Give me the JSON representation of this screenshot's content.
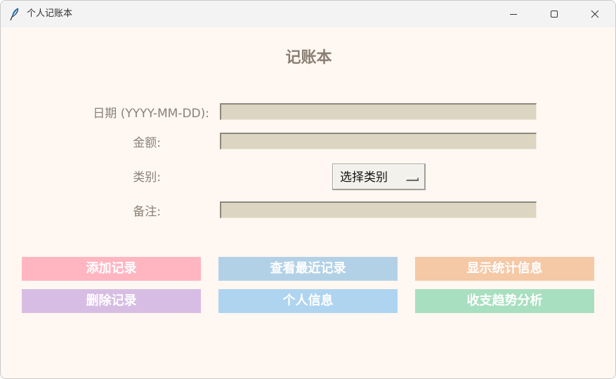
{
  "window": {
    "title": "个人记账本"
  },
  "form": {
    "heading": "记账本",
    "fields": {
      "date": {
        "label": "日期 (YYYY-MM-DD):",
        "value": ""
      },
      "amount": {
        "label": "金额:",
        "value": ""
      },
      "category": {
        "label": "类别:",
        "selected": "选择类别"
      },
      "note": {
        "label": "备注:",
        "value": ""
      }
    }
  },
  "actions": {
    "add": {
      "label": "添加记录",
      "color": "#ffb6c1"
    },
    "view_recent": {
      "label": "查看最近记录",
      "color": "#b3d1e6"
    },
    "stats": {
      "label": "显示统计信息",
      "color": "#f5c8a6"
    },
    "delete": {
      "label": "删除记录",
      "color": "#d7bde3"
    },
    "profile": {
      "label": "个人信息",
      "color": "#aed4f0"
    },
    "trend": {
      "label": "收支趋势分析",
      "color": "#a8dfc0"
    }
  },
  "colors": {
    "background": "#fff7f1",
    "titlebar": "#f3f3f3",
    "entry_bg": "#dbd5c1",
    "label_text": "#8a8278",
    "heading_text": "#8a7f72"
  },
  "icons": {
    "app": "feather-icon",
    "minimize": "minimize-icon",
    "maximize": "maximize-icon",
    "close": "close-icon",
    "dropdown": "option-menu-indicator"
  }
}
